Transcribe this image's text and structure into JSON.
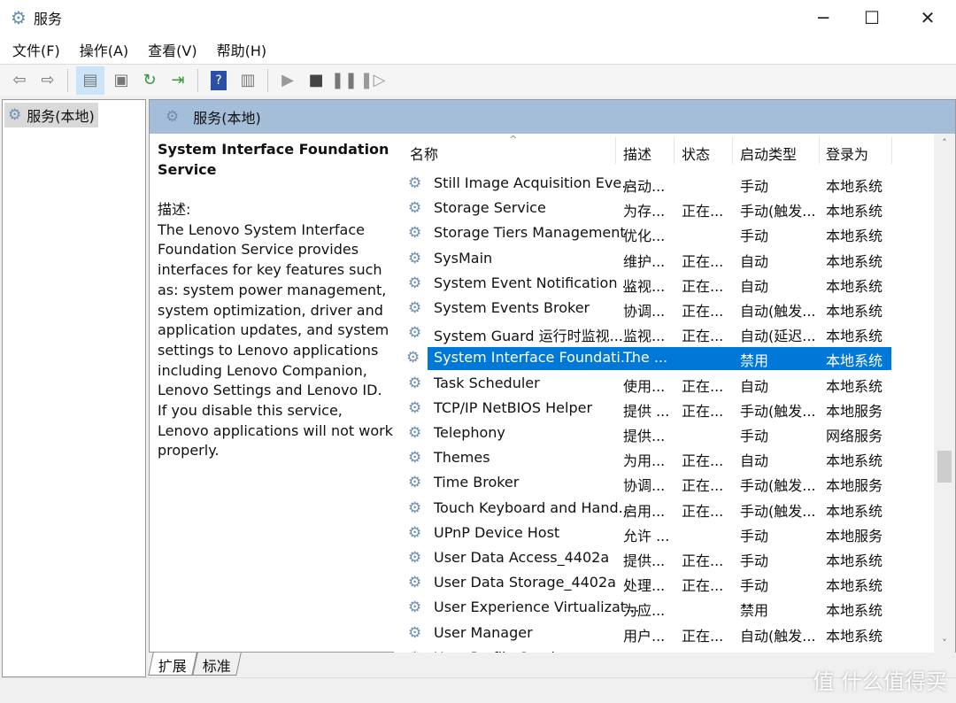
{
  "window": {
    "title": "服务",
    "minimize": "─",
    "maximize": "☐",
    "close": "✕"
  },
  "menu": [
    "文件(F)",
    "操作(A)",
    "查看(V)",
    "帮助(H)"
  ],
  "toolbar": [
    "back-icon",
    "forward-icon",
    "show-console-tree-icon",
    "properties-icon",
    "refresh-icon",
    "export-list-icon",
    "help-icon",
    "show-action-pane-icon",
    "start-service-icon",
    "stop-service-icon",
    "pause-service-icon",
    "resume-service-icon"
  ],
  "tree": {
    "node": "服务(本地)"
  },
  "pane": {
    "title": "服务(本地)"
  },
  "description": {
    "service": "System Interface Foundation Service",
    "label": "描述:",
    "text": "The Lenovo System Interface Foundation Service provides interfaces for key features such as: system power management, system optimization, driver and application updates, and system settings to Lenovo applications including Lenovo Companion, Lenovo Settings and Lenovo ID. If you disable this service, Lenovo applications will not work properly."
  },
  "columns": [
    "名称",
    "描述",
    "状态",
    "启动类型",
    "登录为"
  ],
  "rows": [
    [
      "Still Image Acquisition Eve...",
      "启动...",
      "",
      "手动",
      "本地系统"
    ],
    [
      "Storage Service",
      "为存...",
      "正在...",
      "手动(触发...",
      "本地系统"
    ],
    [
      "Storage Tiers Management",
      "优化...",
      "",
      "手动",
      "本地系统"
    ],
    [
      "SysMain",
      "维护...",
      "正在...",
      "自动",
      "本地系统"
    ],
    [
      "System Event Notification ...",
      "监视...",
      "正在...",
      "自动",
      "本地系统"
    ],
    [
      "System Events Broker",
      "协调...",
      "正在...",
      "自动(触发...",
      "本地系统"
    ],
    [
      "System Guard 运行时监视...",
      "监视...",
      "正在...",
      "自动(延迟...",
      "本地系统"
    ],
    [
      "System Interface Foundati...",
      "The ...",
      "",
      "禁用",
      "本地系统"
    ],
    [
      "Task Scheduler",
      "使用...",
      "正在...",
      "自动",
      "本地系统"
    ],
    [
      "TCP/IP NetBIOS Helper",
      "提供 ...",
      "正在...",
      "手动(触发...",
      "本地服务"
    ],
    [
      "Telephony",
      "提供...",
      "",
      "手动",
      "网络服务"
    ],
    [
      "Themes",
      "为用...",
      "正在...",
      "自动",
      "本地系统"
    ],
    [
      "Time Broker",
      "协调...",
      "正在...",
      "手动(触发...",
      "本地服务"
    ],
    [
      "Touch Keyboard and Hand...",
      "启用...",
      "正在...",
      "手动(触发...",
      "本地系统"
    ],
    [
      "UPnP Device Host",
      "允许 ...",
      "",
      "手动",
      "本地服务"
    ],
    [
      "User Data Access_4402a",
      "提供...",
      "正在...",
      "手动",
      "本地系统"
    ],
    [
      "User Data Storage_4402a",
      "处理...",
      "正在...",
      "手动",
      "本地系统"
    ],
    [
      "User Experience Virtualizat...",
      "为应...",
      "",
      "禁用",
      "本地系统"
    ],
    [
      "User Manager",
      "用户...",
      "正在...",
      "自动(触发...",
      "本地系统"
    ],
    [
      "User Profile Service",
      "此服...",
      "正在...",
      "自动",
      "本地系统"
    ]
  ],
  "selected_row": 7,
  "tabs": [
    "扩展",
    "标准"
  ],
  "watermark": "值 什么值得买",
  "colors": {
    "selection": "#0078d7",
    "pane_header": "#a4bdd8"
  }
}
